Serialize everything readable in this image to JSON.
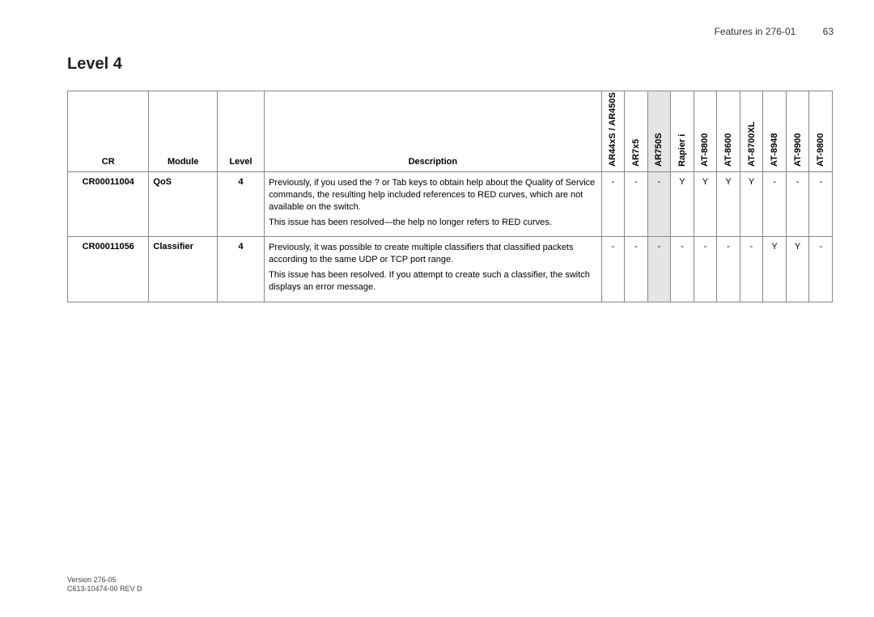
{
  "header": {
    "section": "Features in 276-01",
    "page_number": "63"
  },
  "heading": "Level 4",
  "columns": {
    "cr": "CR",
    "module": "Module",
    "level": "Level",
    "desc": "Description",
    "devices": [
      "AR44xS / AR450S",
      "AR7x5",
      "AR750S",
      "Rapier i",
      "AT-8800",
      "AT-8600",
      "AT-8700XL",
      "AT-8948",
      "AT-9900",
      "AT-9800"
    ]
  },
  "highlight_index": 2,
  "rows": [
    {
      "cr": "CR00011004",
      "module": "QoS",
      "level": "4",
      "desc": [
        "Previously, if you used the ? or Tab keys to obtain help about the Quality of Service commands, the resulting help included references to RED curves, which are not available on the switch.",
        "This issue has been resolved—the help no longer refers to RED curves."
      ],
      "devices": [
        "-",
        "-",
        "-",
        "Y",
        "Y",
        "Y",
        "Y",
        "-",
        "-",
        "-"
      ]
    },
    {
      "cr": "CR00011056",
      "module": "Classifier",
      "level": "4",
      "desc": [
        "Previously, it was possible to create multiple classifiers that classified packets according to the same UDP or TCP port range.",
        "This issue has been resolved. If you attempt to create such a classifier, the switch displays an error message."
      ],
      "devices": [
        "-",
        "-",
        "-",
        "-",
        "-",
        "-",
        "-",
        "Y",
        "Y",
        "-"
      ]
    }
  ],
  "footer": {
    "version": "Version 276-05",
    "rev": "C613-10474-00 REV D"
  }
}
